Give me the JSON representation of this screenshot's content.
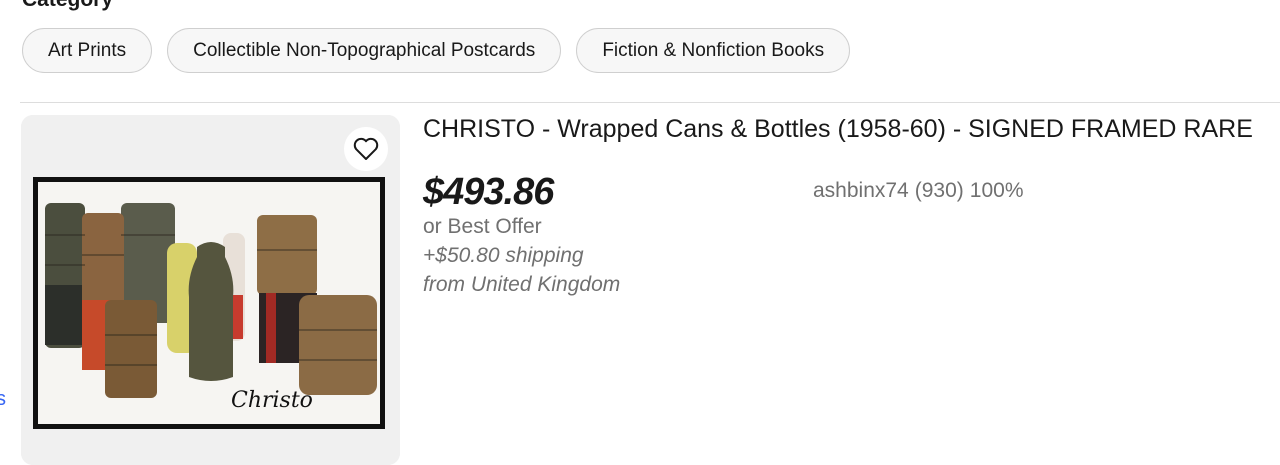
{
  "category": {
    "heading": "Category",
    "pills": [
      {
        "label": "Art Prints"
      },
      {
        "label": "Collectible Non-Topographical Postcards"
      },
      {
        "label": "Fiction & Nonfiction Books"
      }
    ]
  },
  "left_edge_text": "s",
  "listing": {
    "title": "CHRISTO - Wrapped Cans & Bottles (1958-60) - SIGNED FRAMED RARE",
    "price": "$493.86",
    "best_offer": "or Best Offer",
    "shipping": "+$50.80 shipping",
    "location": "from United Kingdom",
    "seller": {
      "name": "ashbinx74",
      "feedback_count": "(930)",
      "feedback_percent": "100%"
    },
    "image": {
      "signature": "Christo",
      "icon": "heart-icon"
    }
  },
  "colors": {
    "link": "#3665f3",
    "muted_text": "#707070",
    "pill_background": "#f7f7f7"
  }
}
